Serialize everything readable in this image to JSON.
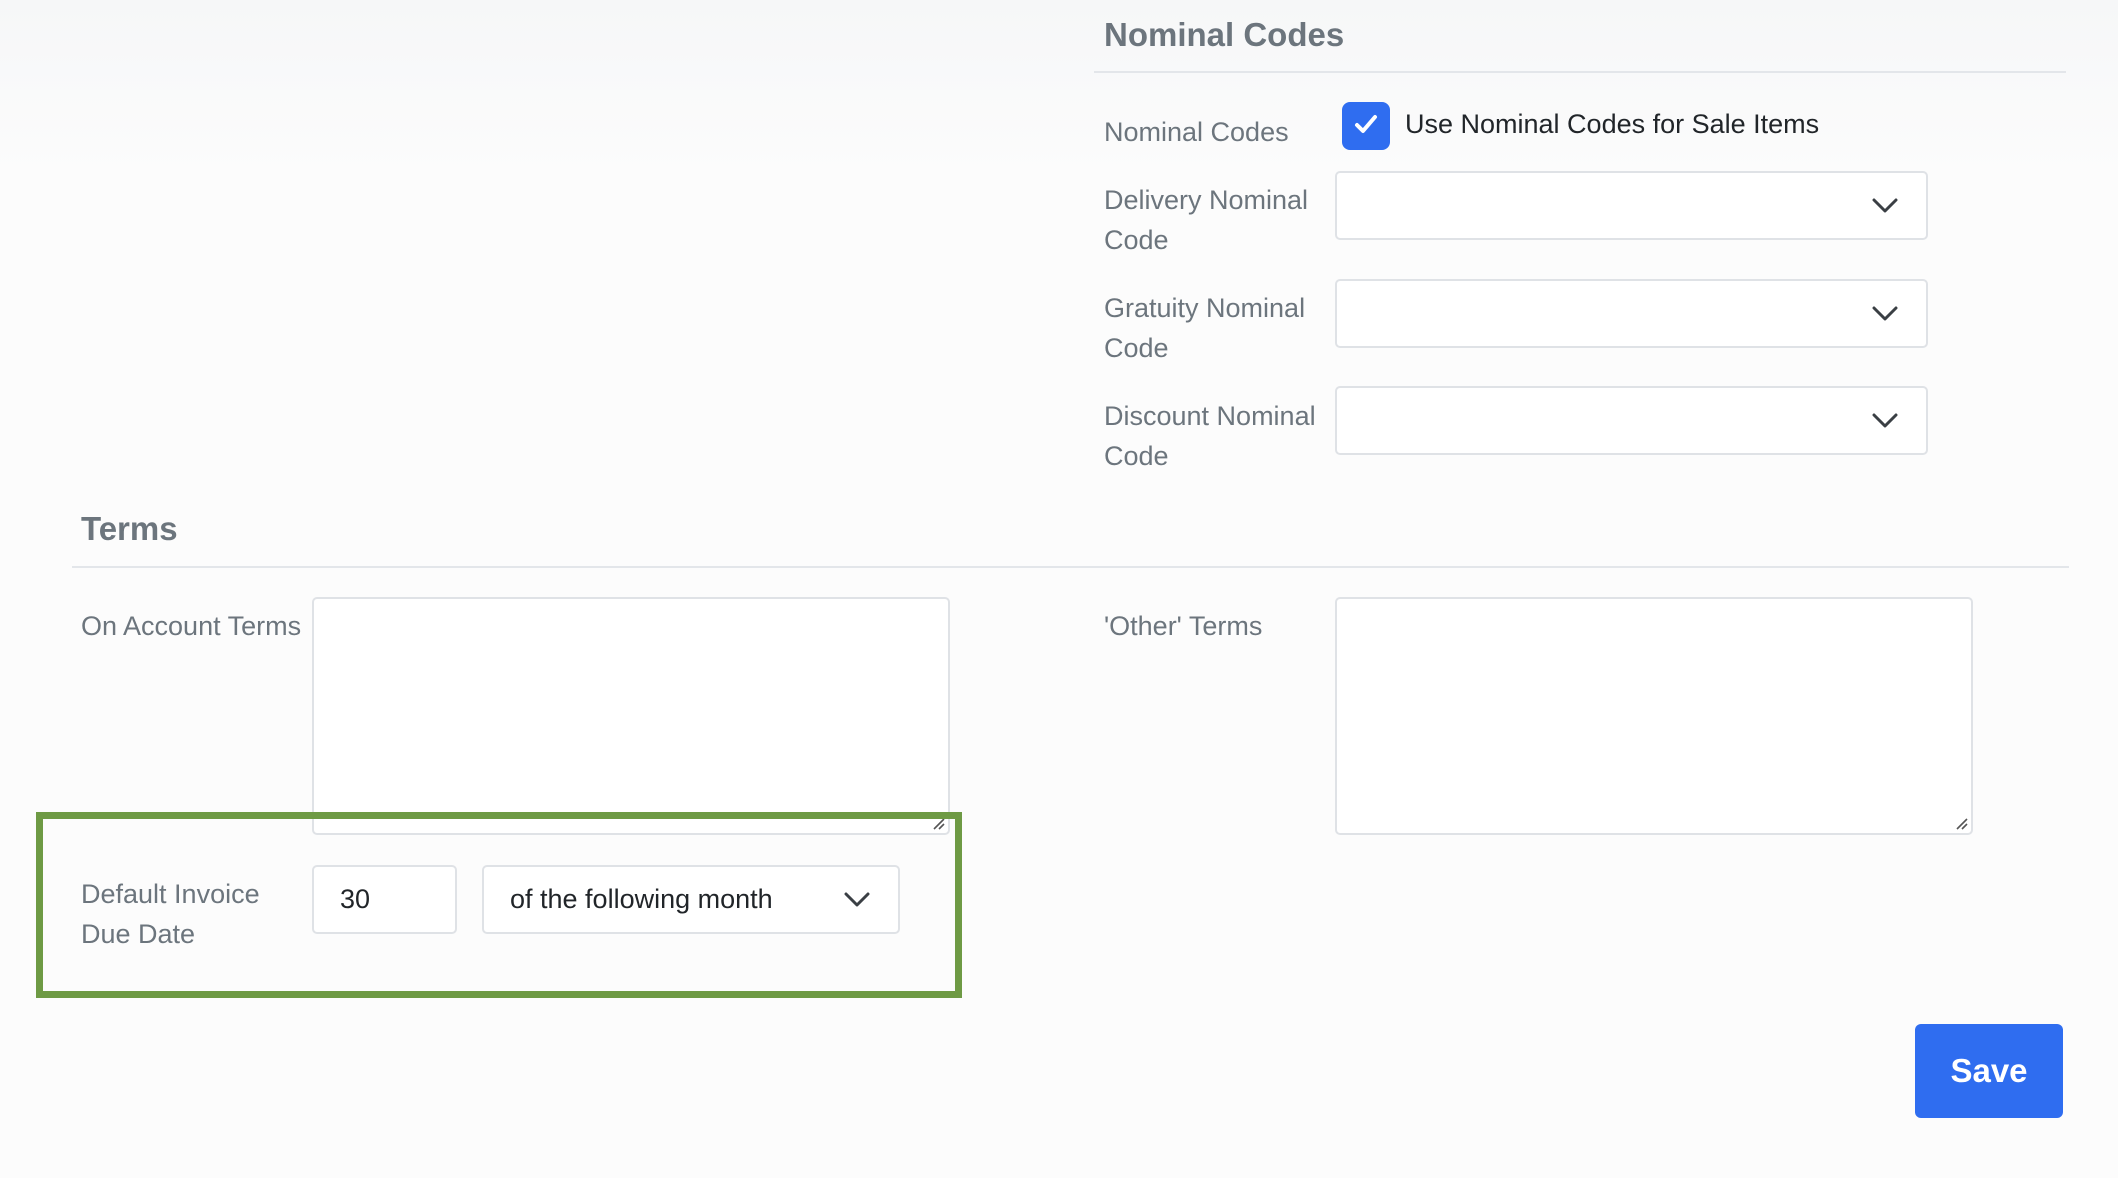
{
  "nominal": {
    "title": "Nominal Codes",
    "use_label": "Nominal Codes",
    "use_checkbox_label": "Use Nominal Codes for Sale Items",
    "use_checked": true,
    "delivery_label_line1": "Delivery Nominal",
    "delivery_label_line2": "Code",
    "delivery_value": "",
    "gratuity_label_line1": "Gratuity Nominal",
    "gratuity_label_line2": "Code",
    "gratuity_value": "",
    "discount_label_line1": "Discount Nominal",
    "discount_label_line2": "Code",
    "discount_value": ""
  },
  "terms": {
    "title": "Terms",
    "on_account_label": "On Account Terms",
    "on_account_value": "",
    "other_label": "'Other' Terms",
    "other_value": "",
    "due_date_label_line1": "Default Invoice",
    "due_date_label_line2": "Due Date",
    "due_date_days": "30",
    "due_date_period": "of the following month"
  },
  "actions": {
    "save_label": "Save"
  },
  "colors": {
    "accent": "#2f6df0",
    "highlight_border": "#6e9a44",
    "label_text": "#6c757d"
  },
  "icons": {
    "checkbox": "checkmark-icon",
    "select": "chevron-down-icon",
    "textarea": "resize-grip-icon"
  }
}
